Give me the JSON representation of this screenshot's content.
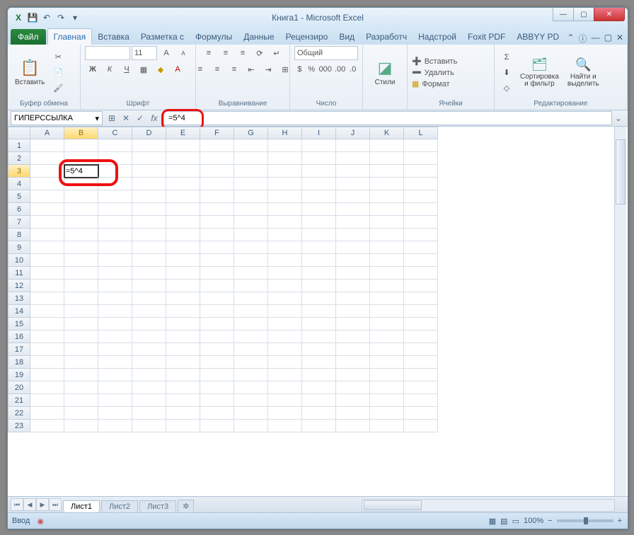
{
  "title": "Книга1 - Microsoft Excel",
  "qat": {
    "excel_icon": "X",
    "save_icon": "💾",
    "undo_icon": "↶",
    "redo_icon": "↷"
  },
  "winbtns": {
    "min": "—",
    "max": "▢",
    "close": "✕"
  },
  "tabs": {
    "file": "Файл",
    "items": [
      "Главная",
      "Вставка",
      "Разметка с",
      "Формулы",
      "Данные",
      "Рецензиро",
      "Вид",
      "Разработч",
      "Надстрой",
      "Foxit PDF",
      "ABBYY PD"
    ],
    "active": 0,
    "help": "ⓘ"
  },
  "ribbon": {
    "clipboard": {
      "label": "Буфер обмена",
      "paste": "Вставить",
      "cut": "✂",
      "copy": "📄",
      "brush": "🖌"
    },
    "font": {
      "label": "Шрифт",
      "size": "11",
      "bold": "Ж",
      "italic": "К",
      "underline": "Ч",
      "dd": "▾",
      "grow": "A",
      "shrink": "A"
    },
    "align": {
      "label": "Выравнивание"
    },
    "number": {
      "label": "Число",
      "format": "Общий"
    },
    "styles": {
      "label": "Стили",
      "btn": "Стили"
    },
    "cells": {
      "label": "Ячейки",
      "insert": "Вставить",
      "delete": "Удалить",
      "format": "Формат"
    },
    "edit": {
      "label": "Редактирование",
      "sort": "Сортировка\nи фильтр",
      "find": "Найти и\nвыделить",
      "sum": "Σ",
      "fill": "⬇",
      "clear": "◇"
    }
  },
  "formulabar": {
    "name": "ГИПЕРССЫЛКА",
    "dd": "▾",
    "cancel": "✕",
    "enter": "✓",
    "fx": "fx",
    "formula": "=5^4"
  },
  "grid": {
    "cols": [
      "A",
      "B",
      "C",
      "D",
      "E",
      "F",
      "G",
      "H",
      "I",
      "J",
      "K",
      "L"
    ],
    "rows": 23,
    "active_col": 1,
    "active_row": 2,
    "cell_value": "=5^4"
  },
  "sheets": {
    "nav": [
      "⏮",
      "◀",
      "▶",
      "⏭"
    ],
    "tabs": [
      "Лист1",
      "Лист2",
      "Лист3"
    ],
    "active": 0,
    "new": "✲"
  },
  "status": {
    "mode": "Ввод",
    "views": [
      "▦",
      "▤",
      "▭"
    ],
    "zoom": "100%",
    "minus": "−",
    "plus": "+",
    "rec": "◉"
  }
}
